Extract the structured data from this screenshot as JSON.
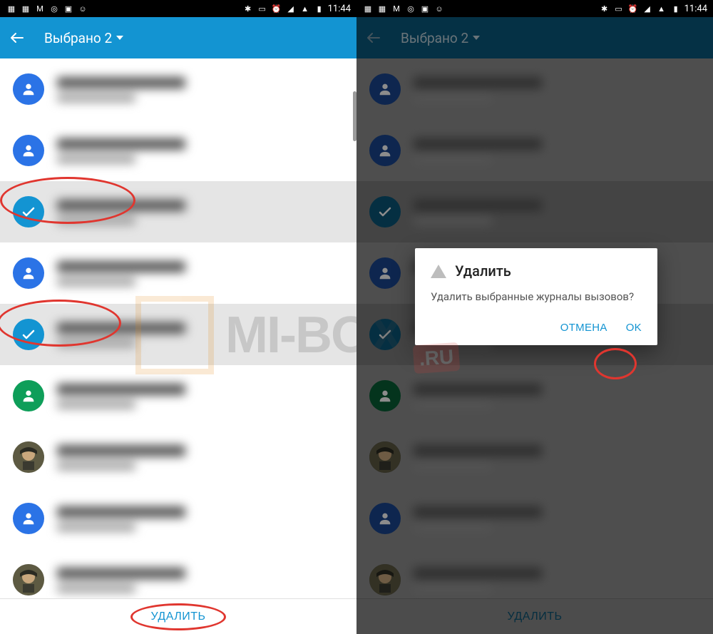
{
  "status": {
    "time": "11:44",
    "icons_left": [
      "calendar-31",
      "calendar-31",
      "gmail",
      "app",
      "photo",
      "incognito"
    ],
    "icons_right": [
      "bluetooth",
      "vibrate",
      "alarm",
      "wifi",
      "signal",
      "battery"
    ]
  },
  "appbar": {
    "title": "Выбрано 2"
  },
  "list": {
    "items": [
      {
        "avatar": "blue",
        "selected": false
      },
      {
        "avatar": "blue",
        "selected": false
      },
      {
        "avatar": "teal",
        "selected": true
      },
      {
        "avatar": "blue",
        "selected": false
      },
      {
        "avatar": "teal",
        "selected": true
      },
      {
        "avatar": "green",
        "selected": false
      },
      {
        "avatar": "photo",
        "selected": false
      },
      {
        "avatar": "blue",
        "selected": false
      },
      {
        "avatar": "photo",
        "selected": false
      }
    ]
  },
  "bottom": {
    "delete": "УДАЛИТЬ"
  },
  "dialog": {
    "title": "Удалить",
    "body": "Удалить выбранные журналы вызовов?",
    "cancel": "ОТМЕНА",
    "ok": "OK"
  },
  "watermark": {
    "text": "MI-BOX",
    "suffix": ".RU"
  }
}
